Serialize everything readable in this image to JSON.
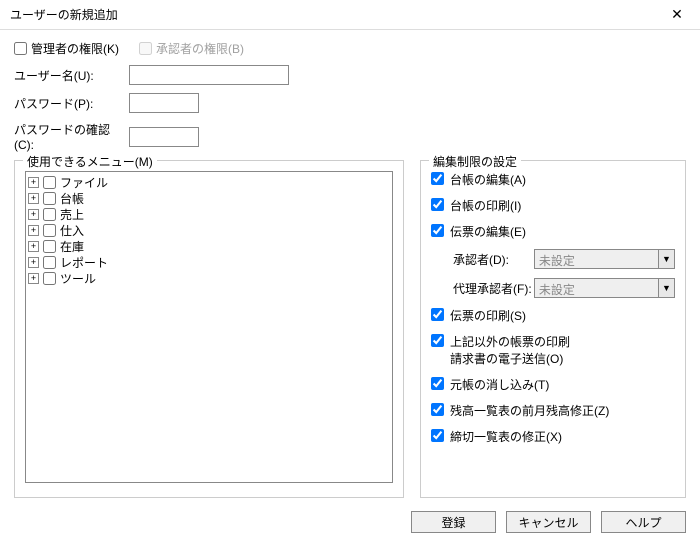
{
  "window": {
    "title": "ユーザーの新規追加"
  },
  "top_checks": {
    "admin": "管理者の権限(K)",
    "approver": "承認者の権限(B)"
  },
  "labels": {
    "username": "ユーザー名(U):",
    "password": "パスワード(P):",
    "password_confirm": "パスワードの確認(C):"
  },
  "fields": {
    "username": "",
    "password": "",
    "password_confirm": ""
  },
  "menu_group": {
    "legend": "使用できるメニュー(M)",
    "items": [
      "ファイル",
      "台帳",
      "売上",
      "仕入",
      "在庫",
      "レポート",
      "ツール"
    ]
  },
  "perm_group": {
    "legend": "編集制限の設定",
    "ledger_edit": "台帳の編集(A)",
    "ledger_print": "台帳の印刷(I)",
    "slip_edit": "伝票の編集(E)",
    "approver_label": "承認者(D):",
    "approver_value": "未設定",
    "proxy_label": "代理承認者(F):",
    "proxy_value": "未設定",
    "slip_print": "伝票の印刷(S)",
    "other_print": "上記以外の帳票の印刷\n請求書の電子送信(O)",
    "offset": "元帳の消し込み(T)",
    "balance_fix": "残高一覧表の前月残高修正(Z)",
    "cutoff_fix": "締切一覧表の修正(X)"
  },
  "buttons": {
    "register": "登録",
    "cancel": "キャンセル",
    "help": "ヘルプ"
  }
}
